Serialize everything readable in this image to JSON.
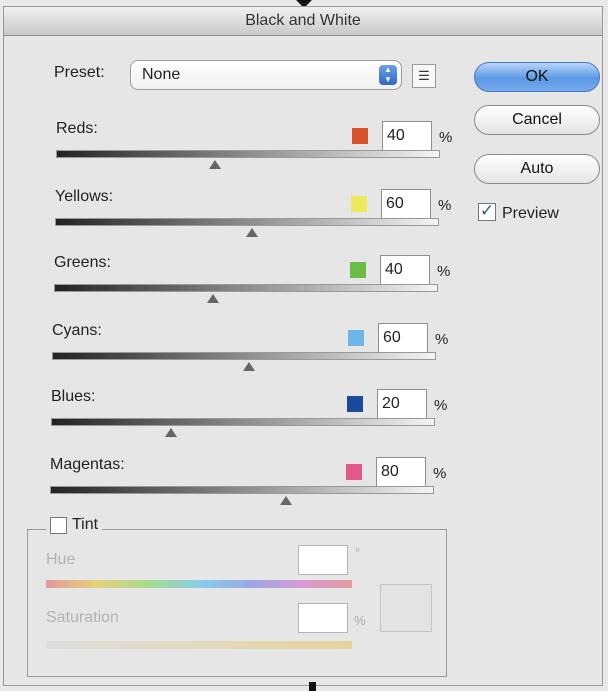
{
  "window": {
    "title": "Black and White"
  },
  "preset": {
    "label": "Preset:",
    "value": "None"
  },
  "buttons": {
    "ok": "OK",
    "cancel": "Cancel",
    "auto": "Auto"
  },
  "preview": {
    "label": "Preview",
    "checked": true
  },
  "percent_sign": "%",
  "sliders": [
    {
      "label": "Reds:",
      "value": "40",
      "level": 40,
      "color": "#d9542d"
    },
    {
      "label": "Yellows:",
      "value": "60",
      "level": 60,
      "color": "#ecea5c"
    },
    {
      "label": "Greens:",
      "value": "40",
      "level": 40,
      "color": "#6abd46"
    },
    {
      "label": "Cyans:",
      "value": "60",
      "level": 60,
      "color": "#6db6e7"
    },
    {
      "label": "Blues:",
      "value": "20",
      "level": 20,
      "color": "#1a4a98"
    },
    {
      "label": "Magentas:",
      "value": "80",
      "level": 80,
      "color": "#e05988"
    }
  ],
  "tint": {
    "label": "Tint",
    "checked": false,
    "hue_label": "Hue",
    "hue_unit": "°",
    "saturation_label": "Saturation",
    "saturation_unit": "%"
  }
}
